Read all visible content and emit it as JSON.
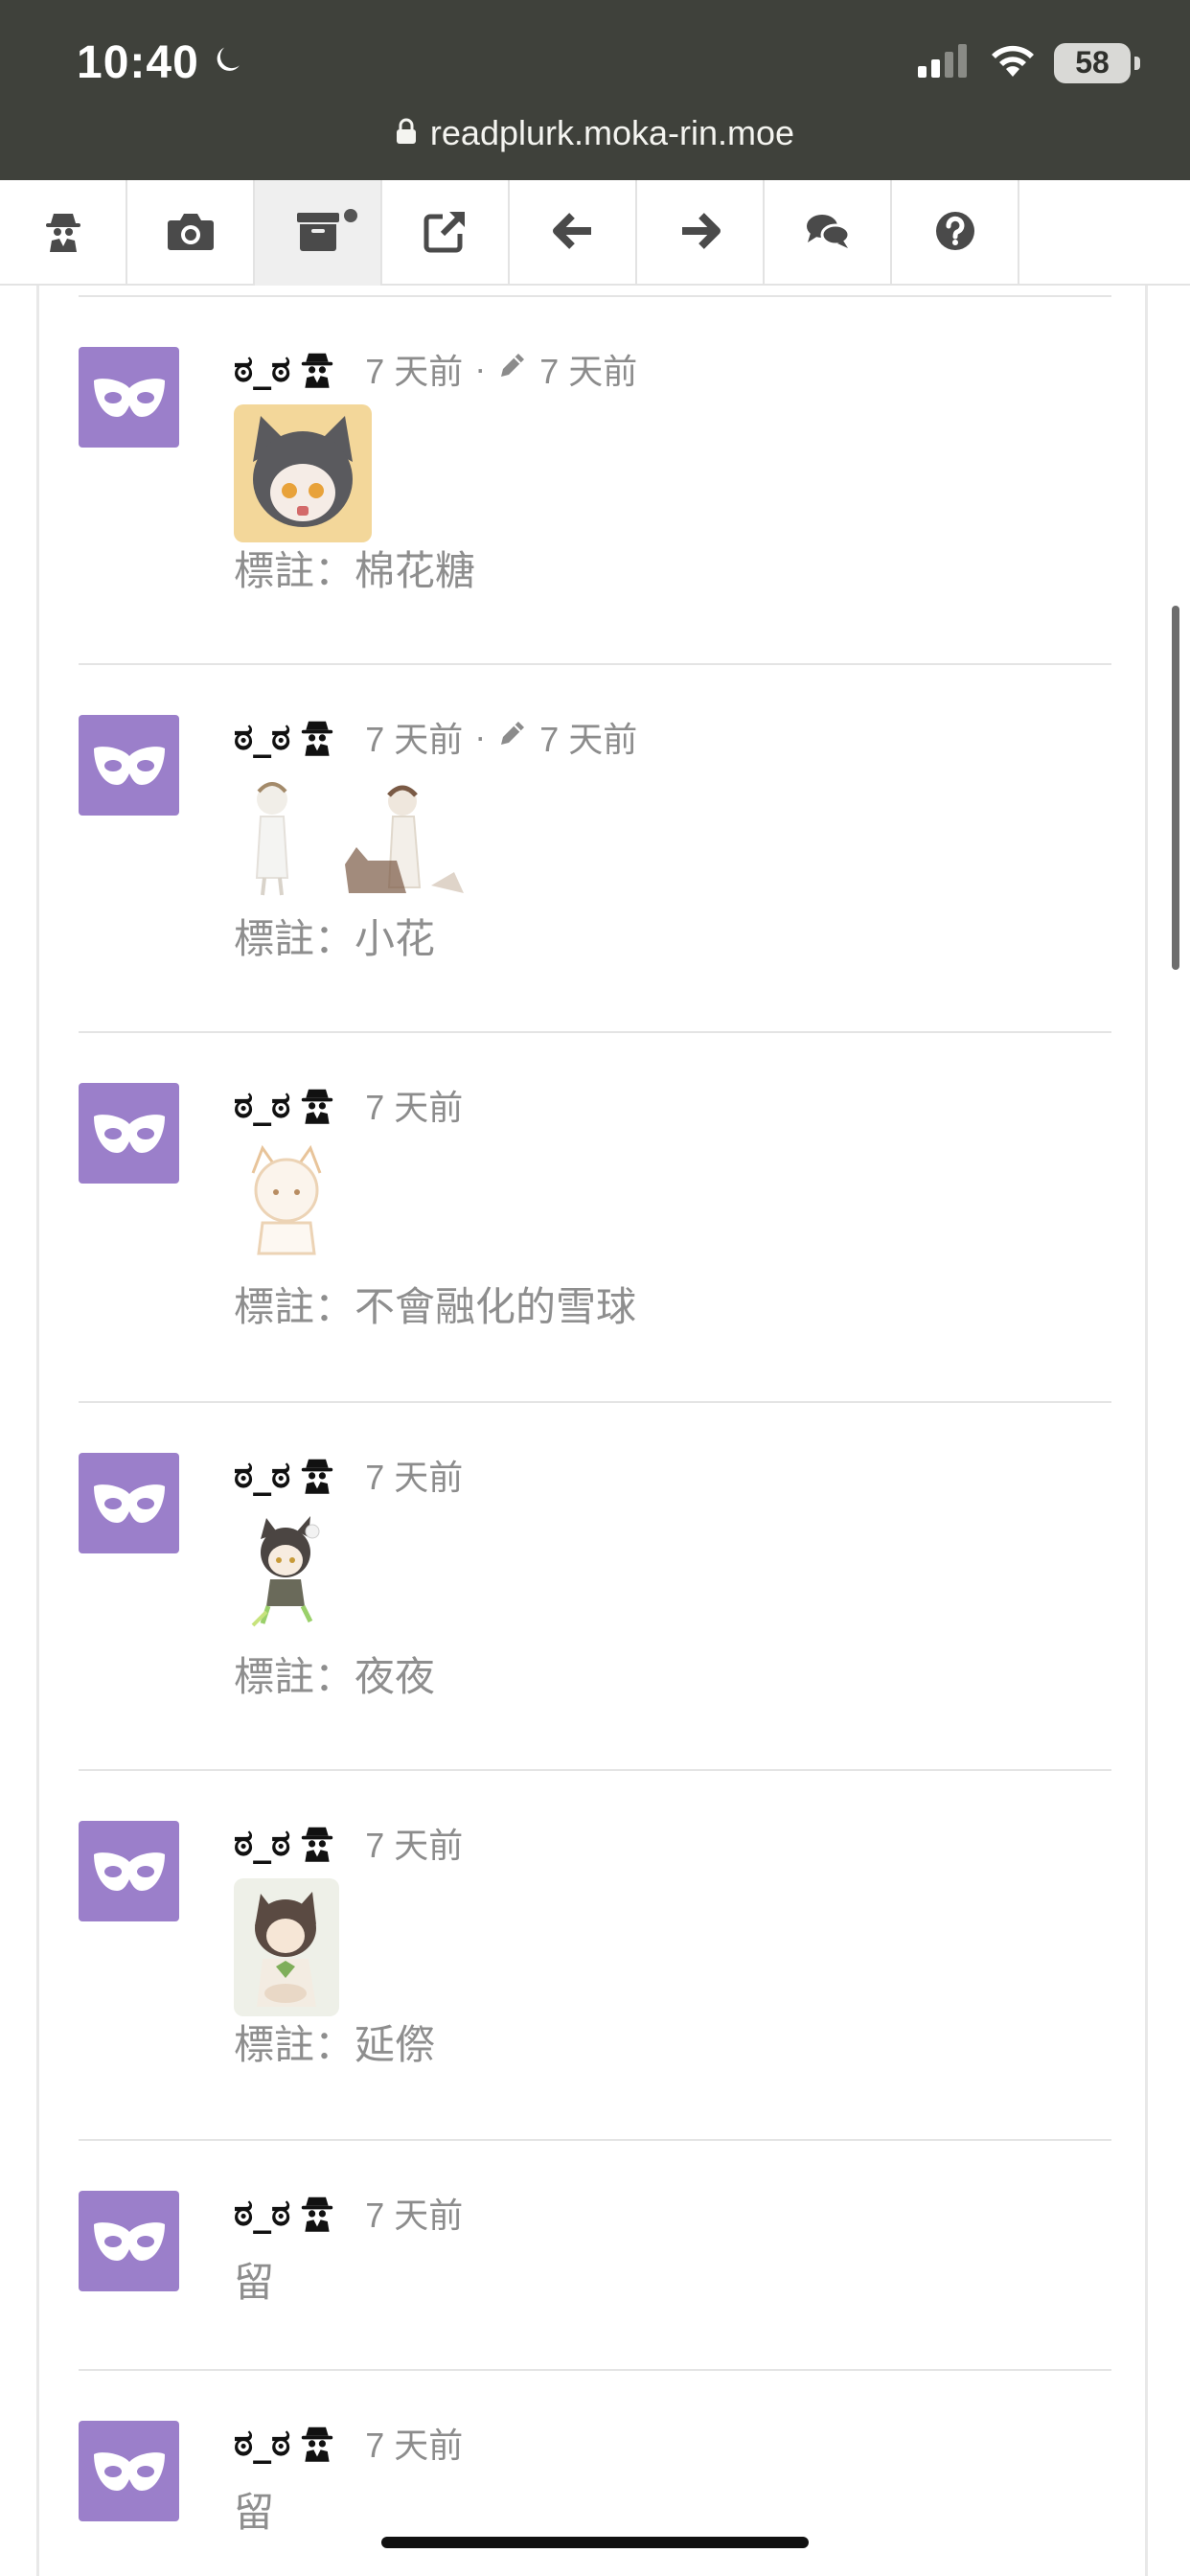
{
  "status": {
    "time": "10:40",
    "battery": "58",
    "url": "readplurk.moka-rin.moe"
  },
  "toolbar": {
    "buttons": [
      "anonymous",
      "camera",
      "archive",
      "external-link",
      "back",
      "forward",
      "comments",
      "help"
    ]
  },
  "posts": [
    {
      "nick": "ಠ_ಠ",
      "time": "7 天前",
      "edited": "7 天前",
      "text": "標註：棉花糖"
    },
    {
      "nick": "ಠ_ಠ",
      "time": "7 天前",
      "edited": "7 天前",
      "text": "標註：小花"
    },
    {
      "nick": "ಠ_ಠ",
      "time": "7 天前",
      "text": "標註：不會融化的雪球"
    },
    {
      "nick": "ಠ_ಠ",
      "time": "7 天前",
      "text": "標註：夜夜"
    },
    {
      "nick": "ಠ_ಠ",
      "time": "7 天前",
      "text": "標註：延傺"
    },
    {
      "nick": "ಠ_ಠ",
      "time": "7 天前",
      "text": "留"
    },
    {
      "nick": "ಠ_ಠ",
      "time": "7 天前",
      "text": "留"
    }
  ],
  "colors": {
    "statusbar": "#3f413b",
    "avatar": "#9b7fca",
    "muted_text": "#8e8e8e"
  }
}
